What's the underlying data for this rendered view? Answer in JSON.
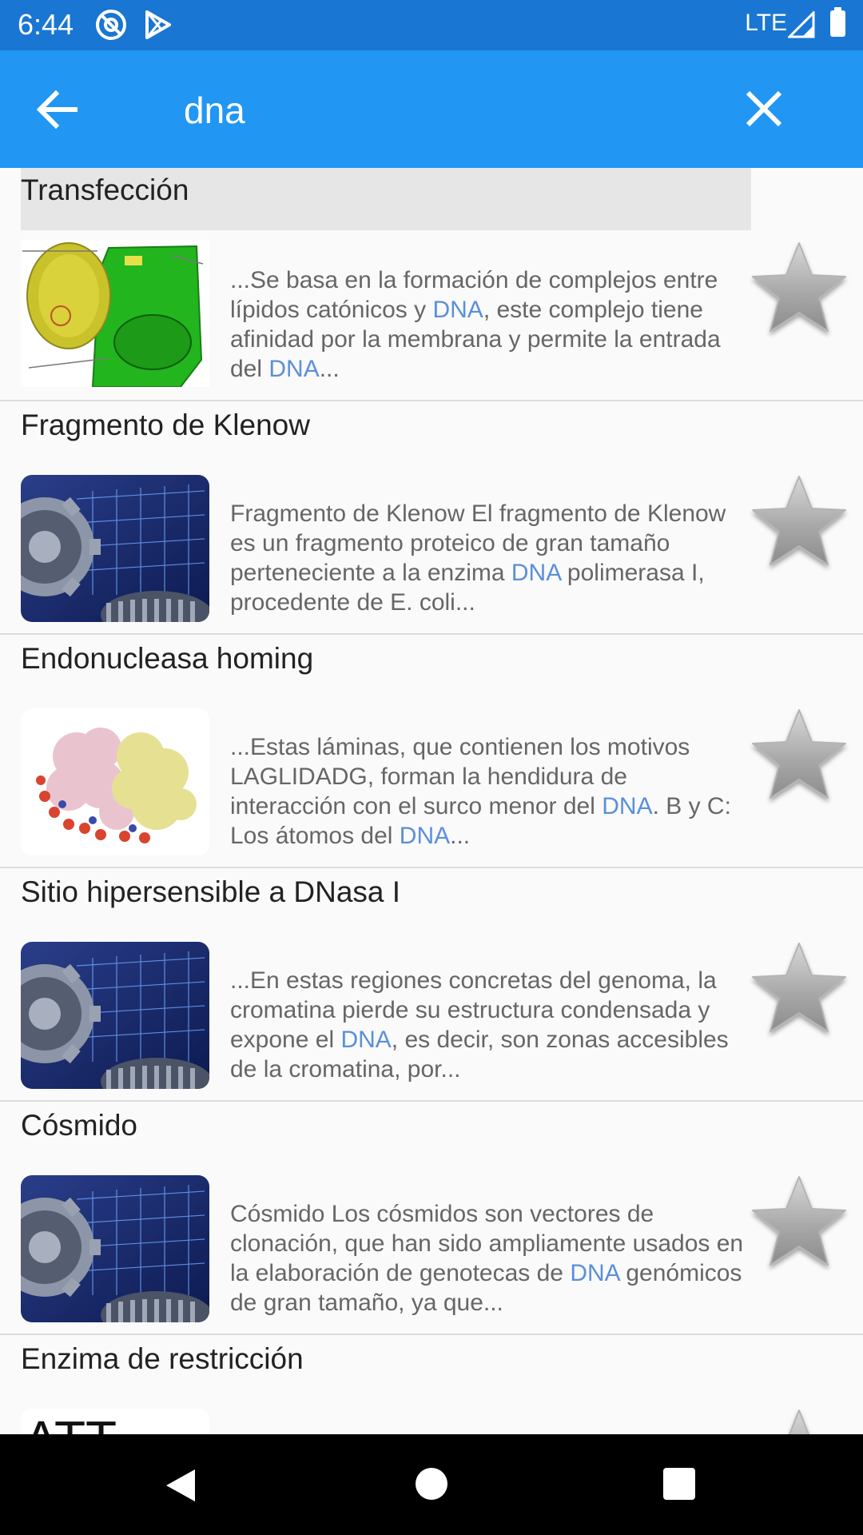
{
  "status_bar": {
    "time": "6:44",
    "network": "LTE",
    "icons": [
      "at-sign-icon",
      "play-store-icon",
      "signal-icon",
      "battery-icon"
    ]
  },
  "app_bar": {
    "query": "dna",
    "icons": [
      "back-arrow-icon",
      "close-icon"
    ]
  },
  "results": [
    {
      "title": "Transfección",
      "snippet_parts": [
        "...Se basa en la formación de complejos entre lípidos catónicos y ",
        "DNA",
        ", este complejo tiene afinidad por la membrana y permite la entrada del ",
        "DNA",
        "..."
      ],
      "thumb": "cell-diagram"
    },
    {
      "title": "Fragmento de Klenow",
      "snippet_parts": [
        "Fragmento de Klenow El fragmento de Klenow es un fragmento proteico de gran tamaño perteneciente a la enzima ",
        "DNA",
        " polimerasa I, procedente de E. coli..."
      ],
      "thumb": "gears"
    },
    {
      "title": "Endonucleasa homing",
      "snippet_parts": [
        "...Estas láminas, que contienen los motivos LAGLIDADG, forman la hendidura de interacción con el surco menor del ",
        "DNA",
        ". B y C: Los átomos del ",
        "DNA",
        "..."
      ],
      "thumb": "protein"
    },
    {
      "title": "Sitio hipersensible a DNasa I",
      "snippet_parts": [
        "...En estas regiones concretas del genoma, la cromatina pierde su estructura condensada y expone el ",
        "DNA",
        ", es decir, son zonas accesibles de la cromatina, por..."
      ],
      "thumb": "gears"
    },
    {
      "title": "Cósmido",
      "snippet_parts": [
        "Cósmido Los cósmidos son vectores de clonación, que han sido ampliamente usados en la elaboración de genotecas de ",
        "DNA",
        " genómicos de gran tamaño, ya que..."
      ],
      "thumb": "gears"
    },
    {
      "title": "Enzima de restricción",
      "snippet_parts": [],
      "thumb": "letters"
    }
  ],
  "colors": {
    "status_bar": "#1976d2",
    "app_bar": "#2196f3",
    "highlight": "#5b8fd8",
    "snippet_text": "#666666"
  }
}
